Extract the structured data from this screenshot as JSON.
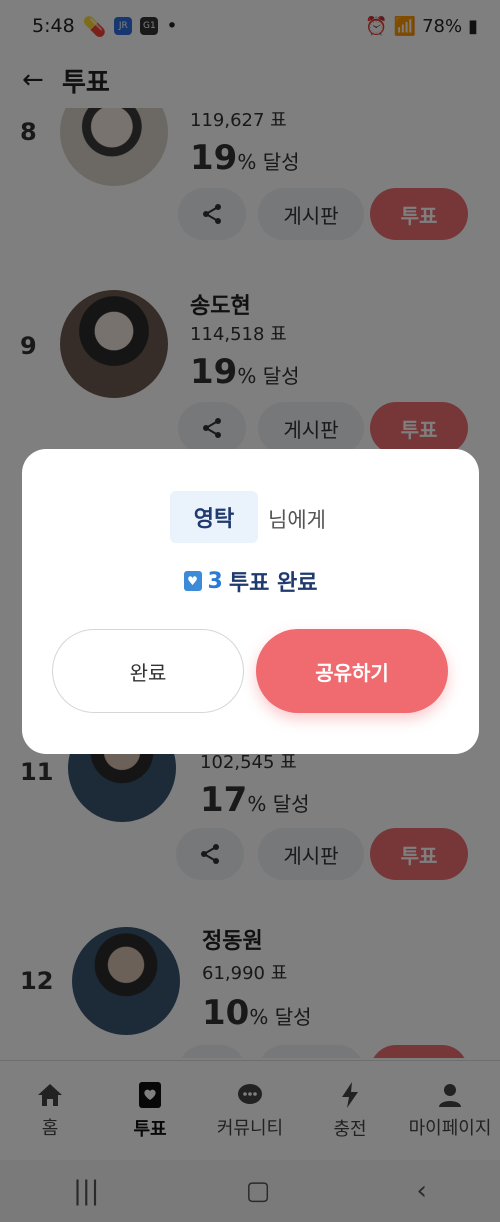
{
  "status": {
    "time": "5:48",
    "battery": "78%"
  },
  "appbar": {
    "title": "투표"
  },
  "rows": [
    {
      "rank": "8",
      "name": "",
      "votes": "119,627 표",
      "pct": "19",
      "pct_unit": "%",
      "achieve": "달성"
    },
    {
      "rank": "9",
      "name": "송도현",
      "votes": "114,518 표",
      "pct": "19",
      "pct_unit": "%",
      "achieve": "달성"
    },
    {
      "rank": "11",
      "name": "",
      "votes": "102,545 표",
      "pct": "17",
      "pct_unit": "%",
      "achieve": "달성"
    },
    {
      "rank": "12",
      "name": "정동원",
      "votes": "61,990 표",
      "pct": "10",
      "pct_unit": "%",
      "achieve": "달성"
    }
  ],
  "row_buttons": {
    "board": "게시판",
    "vote": "투표"
  },
  "dialog": {
    "recipient": "영탁",
    "recipient_suffix": "님에게",
    "vote_count": "3",
    "done_text": "투표 완료",
    "complete_label": "완료",
    "share_label": "공유하기"
  },
  "nav": {
    "home": "홈",
    "vote": "투표",
    "community": "커뮤니티",
    "charge": "충전",
    "mypage": "마이페이지"
  }
}
